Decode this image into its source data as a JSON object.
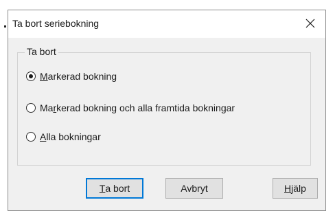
{
  "dialog": {
    "title": "Ta bort seriebokning",
    "close_glyph": "✕"
  },
  "group": {
    "legend": "Ta bort",
    "options": [
      {
        "pre": "",
        "accel": "M",
        "post": "arkerad bokning",
        "checked": true
      },
      {
        "pre": "Ma",
        "accel": "r",
        "post": "kerad bokning och alla framtida bokningar",
        "checked": false
      },
      {
        "pre": "",
        "accel": "A",
        "post": "lla bokningar",
        "checked": false
      }
    ]
  },
  "buttons": {
    "delete": {
      "accel": "T",
      "post": "a bort"
    },
    "cancel": {
      "label": "Avbryt"
    },
    "help": {
      "accel": "H",
      "post": "jälp"
    }
  }
}
